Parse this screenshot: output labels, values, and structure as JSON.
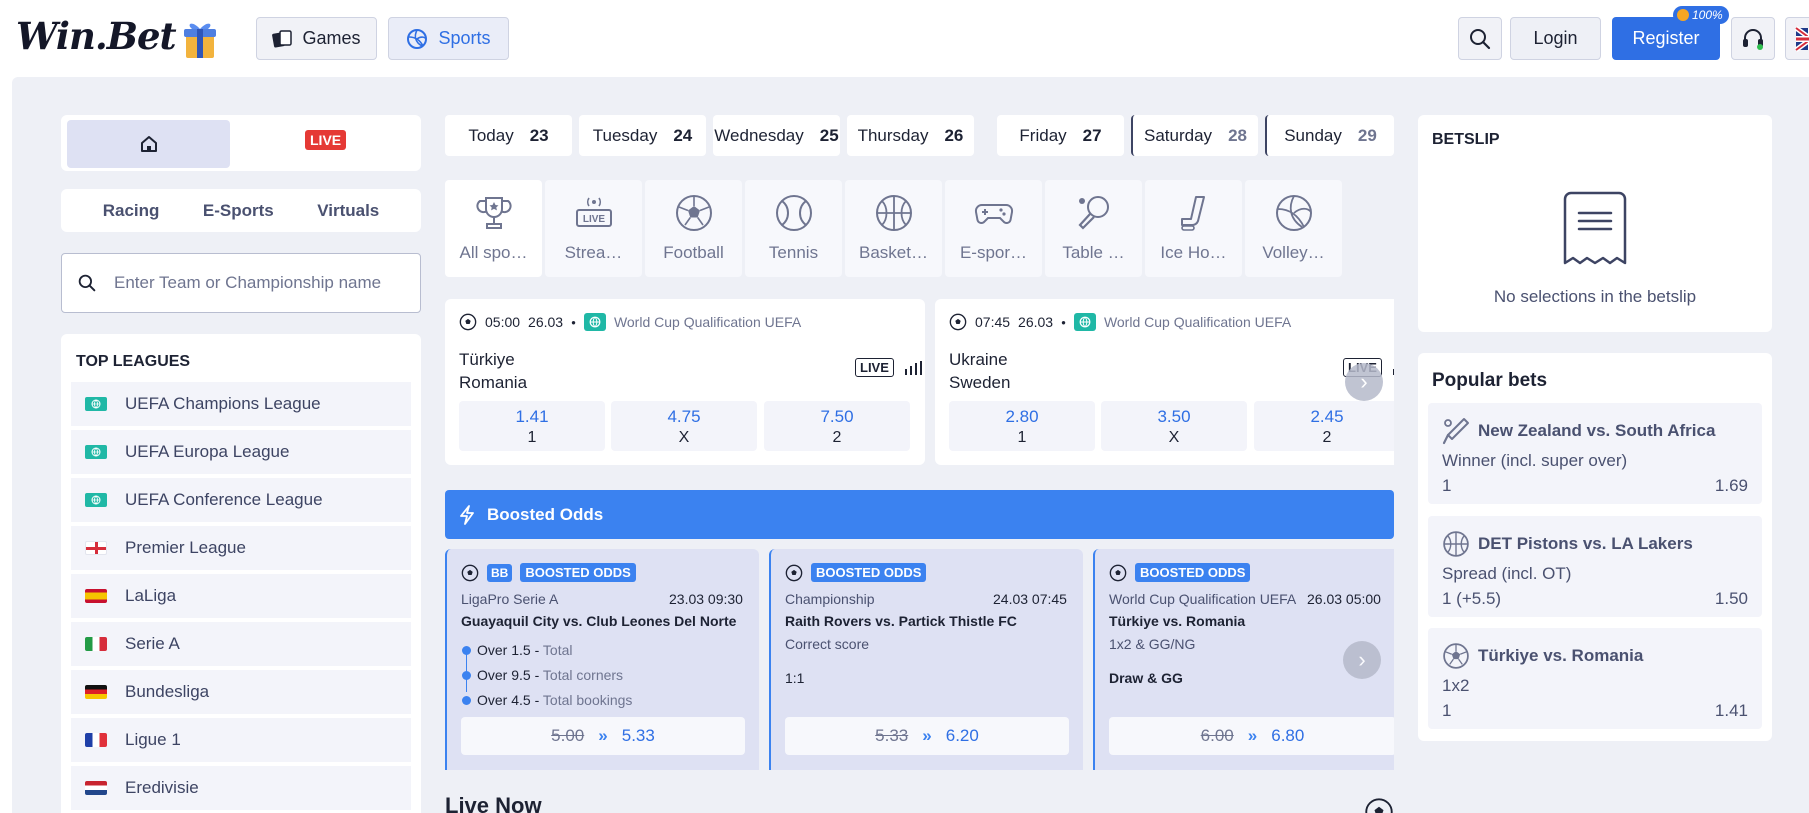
{
  "header": {
    "logo": "Win.Bet",
    "nav": [
      {
        "label": "Games",
        "icon": "cards-icon"
      },
      {
        "label": "Sports",
        "icon": "volleyball-icon"
      }
    ],
    "login_label": "Login",
    "register_label": "Register",
    "promo_percent": "100%"
  },
  "left": {
    "live_label": "LIVE",
    "categories": [
      "Racing",
      "E-Sports",
      "Virtuals"
    ],
    "search_placeholder": "Enter Team or Championship name",
    "top_leagues_title": "TOP LEAGUES",
    "leagues": [
      {
        "label": "UEFA Champions League"
      },
      {
        "label": "UEFA Europa League"
      },
      {
        "label": "UEFA Conference League"
      },
      {
        "label": "Premier League"
      },
      {
        "label": "LaLiga"
      },
      {
        "label": "Serie A"
      },
      {
        "label": "Bundesliga"
      },
      {
        "label": "Ligue 1"
      },
      {
        "label": "Eredivisie"
      }
    ]
  },
  "days": [
    {
      "name": "Today",
      "num": "23"
    },
    {
      "name": "Tuesday",
      "num": "24"
    },
    {
      "name": "Wednesday",
      "num": "25"
    },
    {
      "name": "Thursday",
      "num": "26"
    },
    {
      "name": "Friday",
      "num": "27"
    },
    {
      "name": "Saturday",
      "num": "28"
    },
    {
      "name": "Sunday",
      "num": "29"
    }
  ],
  "sports": [
    {
      "label": "All spo…"
    },
    {
      "label": "Strea…"
    },
    {
      "label": "Football"
    },
    {
      "label": "Tennis"
    },
    {
      "label": "Basket…"
    },
    {
      "label": "E-spor…"
    },
    {
      "label": "Table …"
    },
    {
      "label": "Ice Ho…"
    },
    {
      "label": "Volley…"
    }
  ],
  "matches": [
    {
      "time": "05:00",
      "date": "26.03",
      "competition": "World Cup Qualification UEFA",
      "home": "Türkiye",
      "away": "Romania",
      "live": "LIVE",
      "odds": [
        {
          "value": "1.41",
          "label": "1"
        },
        {
          "value": "4.75",
          "label": "X"
        },
        {
          "value": "7.50",
          "label": "2"
        }
      ]
    },
    {
      "time": "07:45",
      "date": "26.03",
      "competition": "World Cup Qualification UEFA",
      "home": "Ukraine",
      "away": "Sweden",
      "live": "LIVE",
      "odds": [
        {
          "value": "2.80",
          "label": "1"
        },
        {
          "value": "3.50",
          "label": "X"
        },
        {
          "value": "2.45",
          "label": "2"
        }
      ]
    }
  ],
  "boosted": {
    "title": "Boosted Odds",
    "bb_label": "BB",
    "tag": "BOOSTED ODDS",
    "cards": [
      {
        "competition": "LigaPro Serie A",
        "date": "23.03 09:30",
        "match": "Guayaquil City vs. Club Leones Del Norte",
        "legs": [
          {
            "sel": "Over 1.5",
            "market": "Total"
          },
          {
            "sel": "Over 9.5",
            "market": "Total corners"
          },
          {
            "sel": "Over 4.5",
            "market": "Total bookings"
          }
        ],
        "old": "5.00",
        "new": "5.33"
      },
      {
        "competition": "Championship",
        "date": "24.03 07:45",
        "match": "Raith Rovers vs. Partick Thistle FC",
        "market": "Correct score",
        "selection": "1:1",
        "old": "5.33",
        "new": "6.20"
      },
      {
        "competition": "World Cup Qualification UEFA",
        "date": "26.03 05:00",
        "match": "Türkiye vs. Romania",
        "market": "1x2 & GG/NG",
        "selection": "Draw & GG",
        "old": "6.00",
        "new": "6.80"
      }
    ]
  },
  "live_now_title": "Live Now",
  "betslip": {
    "title": "BETSLIP",
    "empty_text": "No selections in the betslip"
  },
  "popular": {
    "title": "Popular bets",
    "items": [
      {
        "event": "New Zealand vs. South Africa",
        "market": "Winner (incl. super over)",
        "outcome": "1",
        "odds": "1.69",
        "icon": "cricket-icon"
      },
      {
        "event": "DET Pistons vs. LA Lakers",
        "market": "Spread (incl. OT)",
        "outcome": "1 (+5.5)",
        "odds": "1.50",
        "icon": "basketball-icon"
      },
      {
        "event": "Türkiye vs. Romania",
        "market": "1x2",
        "outcome": "1",
        "odds": "1.41",
        "icon": "football-icon"
      }
    ]
  },
  "colors": {
    "accent": "#2f6fe4",
    "boost": "#3b82f0",
    "live": "#e53935",
    "background": "#eef0f6"
  }
}
